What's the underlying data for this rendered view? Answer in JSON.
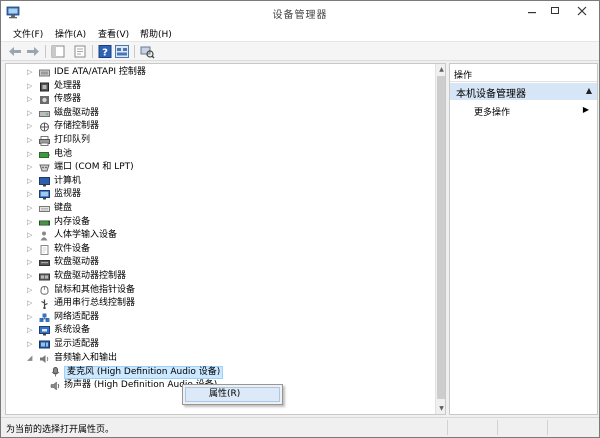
{
  "window": {
    "title": "设备管理器"
  },
  "menubar": {
    "items": [
      "文件(F)",
      "操作(A)",
      "查看(V)",
      "帮助(H)"
    ]
  },
  "toolbar": {
    "buttons": [
      "back-icon",
      "forward-icon",
      "show-hide-tree-icon",
      "properties-icon",
      "help-icon",
      "view-icon",
      "scan-hardware-icon"
    ]
  },
  "tree": {
    "categories": [
      {
        "label": "IDE ATA/ATAPI 控制器",
        "icon": "ide-controller-icon",
        "expanded": false
      },
      {
        "label": "处理器",
        "icon": "processor-icon",
        "expanded": false
      },
      {
        "label": "传感器",
        "icon": "sensor-icon",
        "expanded": false
      },
      {
        "label": "磁盘驱动器",
        "icon": "disk-drive-icon",
        "expanded": false
      },
      {
        "label": "存储控制器",
        "icon": "storage-controller-icon",
        "expanded": false
      },
      {
        "label": "打印队列",
        "icon": "printer-icon",
        "expanded": false
      },
      {
        "label": "电池",
        "icon": "battery-icon",
        "expanded": false
      },
      {
        "label": "端口 (COM 和 LPT)",
        "icon": "port-icon",
        "expanded": false
      },
      {
        "label": "计算机",
        "icon": "computer-icon",
        "expanded": false
      },
      {
        "label": "监视器",
        "icon": "monitor-icon",
        "expanded": false
      },
      {
        "label": "键盘",
        "icon": "keyboard-icon",
        "expanded": false
      },
      {
        "label": "内存设备",
        "icon": "memory-icon",
        "expanded": false
      },
      {
        "label": "人体学输入设备",
        "icon": "hid-icon",
        "expanded": false
      },
      {
        "label": "软件设备",
        "icon": "software-device-icon",
        "expanded": false
      },
      {
        "label": "软盘驱动器",
        "icon": "floppy-icon",
        "expanded": false
      },
      {
        "label": "软盘驱动器控制器",
        "icon": "floppy-controller-icon",
        "expanded": false
      },
      {
        "label": "鼠标和其他指针设备",
        "icon": "mouse-icon",
        "expanded": false
      },
      {
        "label": "通用串行总线控制器",
        "icon": "usb-icon",
        "expanded": false
      },
      {
        "label": "网络适配器",
        "icon": "network-icon",
        "expanded": false
      },
      {
        "label": "系统设备",
        "icon": "system-device-icon",
        "expanded": false
      },
      {
        "label": "显示适配器",
        "icon": "display-adapter-icon",
        "expanded": false
      },
      {
        "label": "音频输入和输出",
        "icon": "audio-icon",
        "expanded": true
      }
    ],
    "audio_children": [
      {
        "label": "麦克风 (High Definition Audio 设备)",
        "icon": "microphone-icon",
        "selected": true
      },
      {
        "label": "扬声器 (High Definition Audio 设备)",
        "icon": "speaker-icon",
        "selected": false
      }
    ]
  },
  "context_menu": {
    "items": [
      "属性(R)"
    ]
  },
  "actions": {
    "header": "操作",
    "section_title": "本机设备管理器",
    "links": [
      "更多操作"
    ]
  },
  "statusbar": {
    "text": "为当前的选择打开属性页。"
  },
  "colors": {
    "selection_bg": "#cce8ff",
    "section_bg": "#d6e6f7",
    "menu_highlight": "#dbe9f8"
  }
}
